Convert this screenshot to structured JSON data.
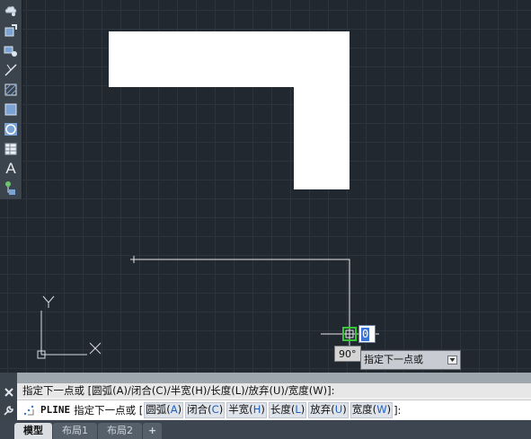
{
  "toolbar": {
    "tools": [
      {
        "name": "revision-cloud-icon"
      },
      {
        "name": "block-editor-icon"
      },
      {
        "name": "insert-block-icon"
      },
      {
        "name": "line-icon"
      },
      {
        "name": "hatch-icon"
      },
      {
        "name": "region-icon"
      },
      {
        "name": "circle-icon"
      },
      {
        "name": "table-icon"
      },
      {
        "name": "text-icon",
        "glyph": "A"
      },
      {
        "name": "add-selected-icon"
      }
    ]
  },
  "canvas": {
    "ucs_x_label": "X",
    "ucs_y_label": "Y"
  },
  "dynamic_input": {
    "value": "0",
    "angle": "90°",
    "prompt": "指定下一点或"
  },
  "command": {
    "history_line": "指定下一点或 [圆弧(A)/闭合(C)/半宽(H)/长度(L)/放弃(U)/宽度(W)]:",
    "name": "PLINE",
    "prompt": "指定下一点或 [",
    "options": [
      {
        "label": "圆弧(",
        "key": "A",
        "end": ")"
      },
      {
        "label": "闭合(",
        "key": "C",
        "end": ")"
      },
      {
        "label": "半宽(",
        "key": "H",
        "end": ")"
      },
      {
        "label": "长度(",
        "key": "L",
        "end": ")"
      },
      {
        "label": "放弃(",
        "key": "U",
        "end": ")"
      },
      {
        "label": "宽度(",
        "key": "W",
        "end": ")"
      }
    ],
    "prompt_end": "]:"
  },
  "tabs": [
    "模型",
    "布局1",
    "布局2",
    "+"
  ],
  "colors": {
    "background": "#212830",
    "grid": "#2c343d",
    "shape_fill": "#ffffff",
    "polyline": "#e6e6e6",
    "snap_marker": "#37c837",
    "option_key": "#1f5fbf"
  }
}
